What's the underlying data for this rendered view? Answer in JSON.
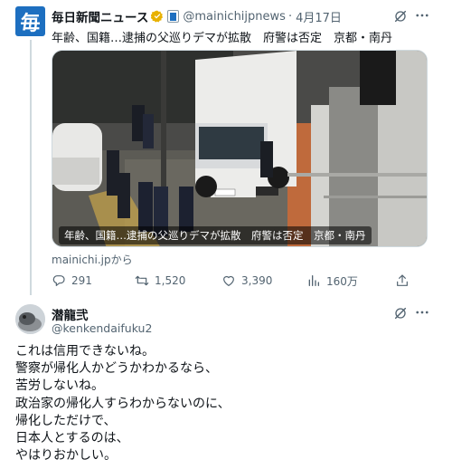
{
  "tweet1": {
    "author_name": "毎日新聞ニュース",
    "avatar_text": "毎",
    "handle": "@mainichijpnews",
    "dot": "·",
    "date": "4月17日",
    "text": "年齢、国籍…逮捕の父巡りデマが拡散　府警は否定　京都・南丹",
    "media_caption": "年齢、国籍…逮捕の父巡りデマが拡散　府警は否定　京都・南丹",
    "source": "mainichi.jpから",
    "stats": {
      "replies": "291",
      "reposts": "1,520",
      "likes": "3,390",
      "views": "160万"
    }
  },
  "tweet2": {
    "author_name": "潜龍弐",
    "handle": "@kenkendaifuku2",
    "lines": [
      "これは信用できないね。",
      "警察が帰化人かどうかわかるなら、",
      "苦労しないね。",
      "政治家の帰化人すらわからないのに、",
      "帰化しただけで、",
      "日本人とするのは、",
      "やはりおかしい。"
    ]
  },
  "colors": {
    "avatar_blue": "#1d6fc0",
    "verified_gold": "#e8b100",
    "muted_text": "#536471"
  },
  "icons": [
    "grok-icon",
    "more-icon",
    "reply-icon",
    "repost-icon",
    "like-icon",
    "views-icon",
    "share-icon",
    "verified-badge-icon",
    "org-badge-icon"
  ]
}
